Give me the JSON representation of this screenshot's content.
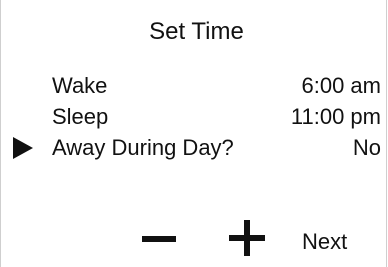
{
  "header": {
    "title": "Set Time"
  },
  "settings": {
    "rows": [
      {
        "label": "Wake",
        "value": "6:00 am",
        "selected": false
      },
      {
        "label": "Sleep",
        "value": "11:00 pm",
        "selected": false
      },
      {
        "label": "Away During Day?",
        "value": "No",
        "selected": true
      }
    ]
  },
  "controls": {
    "decrease_icon": "minus-icon",
    "increase_icon": "plus-icon",
    "selection_icon": "triangle-right-icon",
    "next_label": "Next"
  },
  "colors": {
    "background": "#ffffff",
    "foreground": "#111111",
    "border": "#cfcfcf"
  }
}
